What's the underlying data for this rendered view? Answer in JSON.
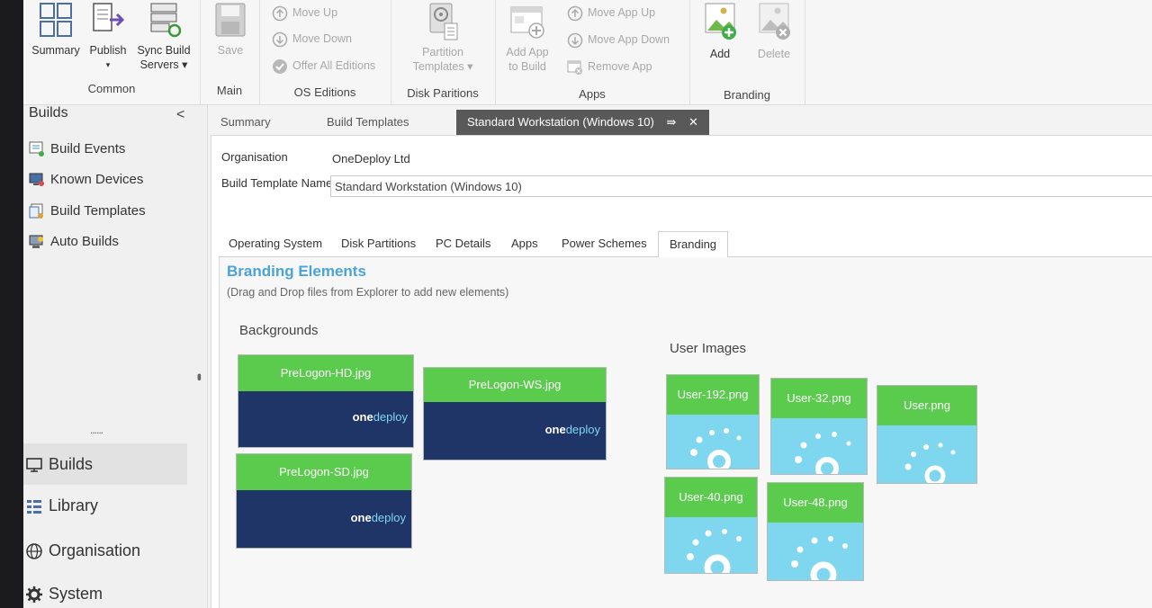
{
  "ribbon": {
    "common": {
      "label": "Common",
      "summary": "Summary",
      "publish": "Publish",
      "publish_arrow": "▾",
      "sync_line1": "Sync Build",
      "sync_line2": "Servers ▾"
    },
    "main": {
      "label": "Main",
      "save": "Save"
    },
    "os_editions": {
      "label": "OS Editions",
      "move_up": "Move Up",
      "move_down": "Move Down",
      "offer_all": "Offer All Editions"
    },
    "disk": {
      "label": "Disk Paritions",
      "partition_line1": "Partition",
      "partition_line2": "Templates ▾"
    },
    "apps": {
      "label": "Apps",
      "add_line1": "Add App",
      "add_line2": "to Build",
      "move_up": "Move App Up",
      "move_down": "Move App Down",
      "remove": "Remove App"
    },
    "branding": {
      "label": "Branding",
      "add": "Add",
      "delete": "Delete"
    }
  },
  "sidebar": {
    "title": "Builds",
    "collapse": "<",
    "items": [
      {
        "label": "Build Events",
        "icon": "build-events-icon"
      },
      {
        "label": "Known Devices",
        "icon": "known-devices-icon"
      },
      {
        "label": "Build Templates",
        "icon": "build-templates-icon"
      },
      {
        "label": "Auto Builds",
        "icon": "auto-builds-icon"
      }
    ],
    "grip": "......",
    "nav": [
      {
        "label": "Builds",
        "icon": "monitor-icon"
      },
      {
        "label": "Library",
        "icon": "library-icon"
      },
      {
        "label": "Organisation",
        "icon": "globe-icon"
      },
      {
        "label": "System",
        "icon": "gear-icon"
      }
    ]
  },
  "doc_tabs": {
    "summary": "Summary",
    "build_templates": "Build Templates",
    "active": "Standard Workstation (Windows 10)",
    "pin": "⇛",
    "close": "✕"
  },
  "form": {
    "org_label": "Organisation",
    "org_value": "OneDeploy Ltd",
    "name_label": "Build Template Name",
    "name_value": "Standard Workstation (Windows 10)"
  },
  "sub_tabs": [
    "Operating System",
    "Disk Partitions",
    "PC Details",
    "Apps",
    "Power Schemes",
    "Branding"
  ],
  "branding": {
    "title": "Branding Elements",
    "subtitle": "(Drag and Drop files from Explorer to add new elements)",
    "backgrounds_label": "Backgrounds",
    "user_images_label": "User Images",
    "backgrounds": [
      "PreLogon-HD.jpg",
      "PreLogon-WS.jpg",
      "PreLogon-SD.jpg"
    ],
    "user_images": [
      "User-192.png",
      "User-32.png",
      "User.png",
      "User-40.png",
      "User-48.png"
    ],
    "logo_bold": "one",
    "logo_light": "deploy"
  },
  "colors": {
    "accent": "#4aa3d9",
    "tile_header": "#5bcb4e",
    "navy": "#1f3467",
    "sky": "#7fd7ef"
  }
}
